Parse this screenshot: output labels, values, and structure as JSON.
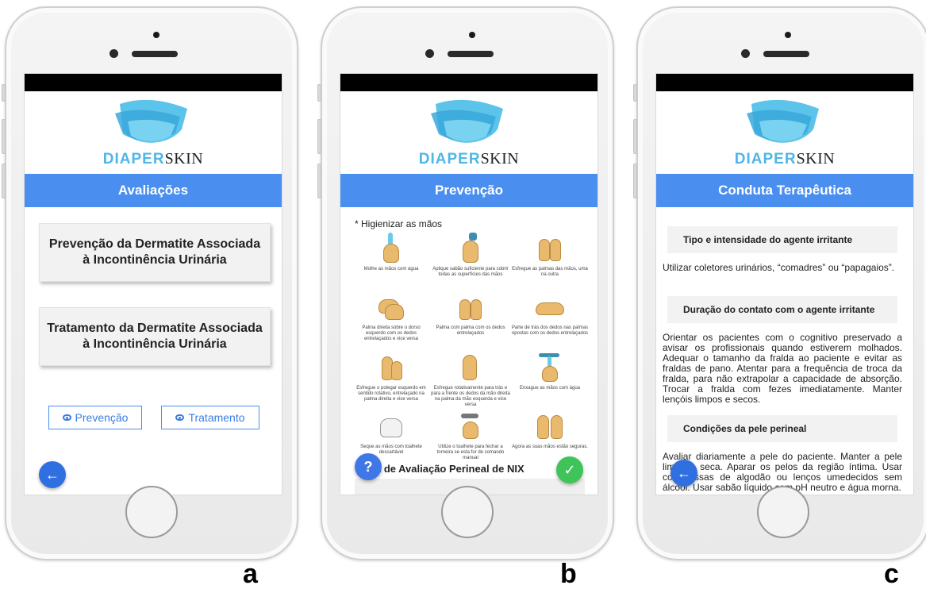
{
  "logo": {
    "part1": "DIAPER",
    "part2": "SKIN"
  },
  "screen_a": {
    "title": "Avaliações",
    "cards": [
      "Prevenção da Dermatite Associada à Incontinência Urinária",
      "Tratamento da Dermatite Associada à Incontinência Urinária"
    ],
    "buttons": [
      "Prevenção",
      "Tratamento"
    ],
    "back_icon": "arrow-left-icon"
  },
  "screen_b": {
    "title": "Prevenção",
    "note": "* Higienizar as mãos",
    "steps": [
      "Molhe as mãos com água",
      "Aplique sabão suficiente para cobrir todas as superfícies das mãos",
      "Esfregue as palmas das mãos, uma na outra",
      "Palma direita sobre o dorso esquerdo com os dedos entrelaçados e vice versa",
      "Palma com palma com os dedos entrelaçados",
      "Parte de trás dos dedos nas palmas opostas com os dedos entrelaçados",
      "Esfregue o polegar esquerdo em sentido rotativo, entrelaçado na palma direita e vice versa",
      "Esfregue rotativamente para trás e para a frente os dedos da mão direita na palma da mão esquerda e vice versa",
      "Enxague as mãos com água",
      "Seque as mãos com toalhete descartável",
      "Utilize o toalhete para fechar a torneira se esta for de comando manual",
      "Agora as suas mãos estão seguras."
    ],
    "section_partial": "a de Avaliação Perineal de NIX",
    "help_label": "?",
    "confirm_icon": "check-icon"
  },
  "screen_c": {
    "title": "Conduta Terapêutica",
    "sections": [
      {
        "heading": "Tipo e intensidade do agente irritante",
        "text": "Utilizar coletores urinários, “comadres” ou “papagaios”."
      },
      {
        "heading": "Duração do contato com o agente irritante",
        "text": "Orientar os pacientes com o cognitivo preservado a avisar os profissionais quando estiverem molhados. Adequar o tamanho da fralda ao paciente e evitar as fraldas de pano. Atentar para a frequência de troca da fralda, para não extrapolar a capacidade de absorção. Trocar a fralda com fezes imediatamente. Manter lençóis limpos e secos."
      },
      {
        "heading": "Condições da pele perineal",
        "text": "Avaliar diariamente a pele do paciente. Manter a pele limpa e seca. Aparar os pelos da região íntima. Usar compressas de algodão ou lenços umedecidos sem álcool. Usar sabão líquido com pH neutro e água morna."
      }
    ],
    "back_icon": "arrow-left-icon"
  },
  "panel_labels": [
    "a",
    "b",
    "c"
  ]
}
